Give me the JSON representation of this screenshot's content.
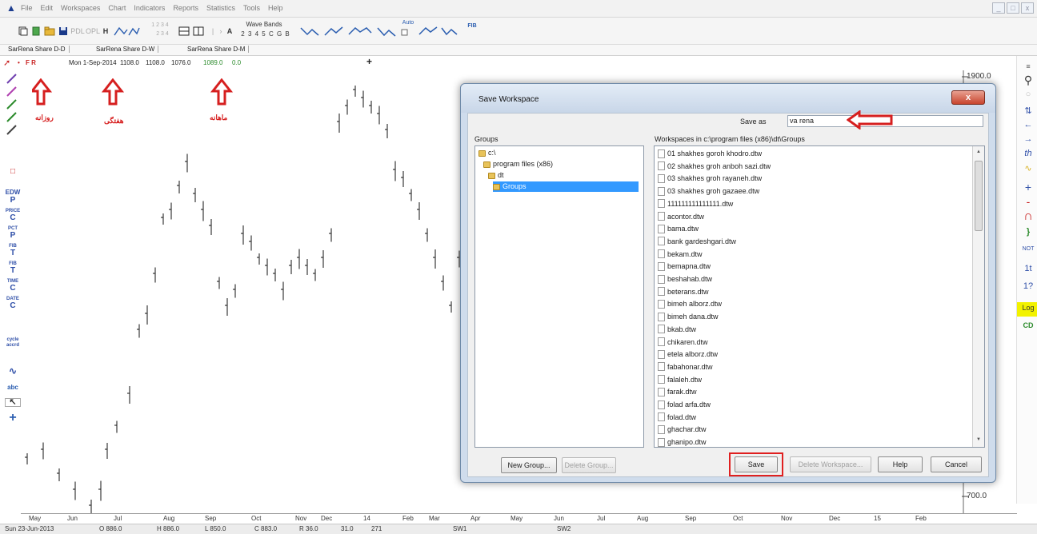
{
  "menu": {
    "items": [
      "File",
      "Edit",
      "Workspaces",
      "Chart",
      "Indicators",
      "Reports",
      "Statistics",
      "Tools",
      "Help"
    ],
    "window_controls": [
      "_",
      "□",
      "x"
    ]
  },
  "toolbar": {
    "pdl_label": "PDL",
    "opl_label": "OPL",
    "h_label": "H",
    "digits_top": "1 2 3 4",
    "digits_bottom": "2 3 4",
    "a_label": "A",
    "wave_bands_label": "Wave Bands",
    "wave_digits": "2 3 4 5 C G B",
    "auto_label": "Auto",
    "fib_label": "FIB"
  },
  "tabs": [
    "SarRena Share D-D",
    "SarRena Share D-W",
    "SarRena Share D-M"
  ],
  "infobar": {
    "flags": "F R",
    "date": "Mon 1-Sep-2014",
    "open": "1108.0",
    "high": "1108.0",
    "low": "1076.0",
    "close": "1089.0",
    "change": "0.0"
  },
  "annotations": {
    "daily": "روزانه",
    "weekly": "هفتگی",
    "monthly": "ماهانه"
  },
  "chart": {
    "price_high_label": "1900.0",
    "price_low_label": "700.0",
    "time_labels": [
      "May",
      "Jun",
      "Jul",
      "Aug",
      "Sep",
      "Oct",
      "Nov",
      "Dec",
      "14",
      "Feb",
      "Mar",
      "Apr",
      "May",
      "Jun",
      "Jul",
      "Aug",
      "Sep",
      "Oct",
      "Nov",
      "Dec",
      "15",
      "Feb"
    ]
  },
  "left_tools": [
    "EDW",
    "P",
    "PRICE",
    "C",
    "PCT",
    "P",
    "FIB",
    "T",
    "FIB",
    "T",
    "TIME",
    "C",
    "DATE",
    "C",
    "cycle accrd",
    "abc"
  ],
  "right_tools": [
    "Log",
    "CD"
  ],
  "status": {
    "date": "Sun 23-Jun-2013",
    "o": "O 886.0",
    "h": "H 886.0",
    "l": "L 850.0",
    "c": "C 883.0",
    "r": "R 36.0",
    "v1": "31.0",
    "v2": "271",
    "sw1": "SW1",
    "sw2": "SW2"
  },
  "dialog": {
    "title": "Save Workspace",
    "close": "x",
    "save_as_label": "Save as",
    "save_as_value": "va rena",
    "groups_label": "Groups",
    "workspaces_label": "Workspaces in  c:\\program files (x86)\\dt\\Groups",
    "groups_tree": [
      {
        "label": "c:\\",
        "selected": false
      },
      {
        "label": "program files (x86)",
        "selected": false
      },
      {
        "label": "dt",
        "selected": false
      },
      {
        "label": "Groups",
        "selected": true
      }
    ],
    "workspaces": [
      "01   shakhes goroh khodro.dtw",
      "02   shakhes groh anboh sazi.dtw",
      "03   shakhes groh rayaneh.dtw",
      "03   shakhes groh gazaee.dtw",
      "111111111111111.dtw",
      "acontor.dtw",
      "bama.dtw",
      "bank gardeshgari.dtw",
      "bekam.dtw",
      "bemapna.dtw",
      "beshahab.dtw",
      "beterans.dtw",
      "bimeh alborz.dtw",
      "bimeh dana.dtw",
      "bkab.dtw",
      "chikaren.dtw",
      "etela alborz.dtw",
      "fabahonar.dtw",
      "falaleh.dtw",
      "farak.dtw",
      "folad arfa.dtw",
      "folad.dtw",
      "ghachar.dtw",
      "ghanipo.dtw"
    ],
    "buttons": {
      "new_group": "New Group...",
      "delete_group": "Delete Group...",
      "save": "Save",
      "delete_workspace": "Delete Workspace...",
      "help": "Help",
      "cancel": "Cancel"
    }
  }
}
